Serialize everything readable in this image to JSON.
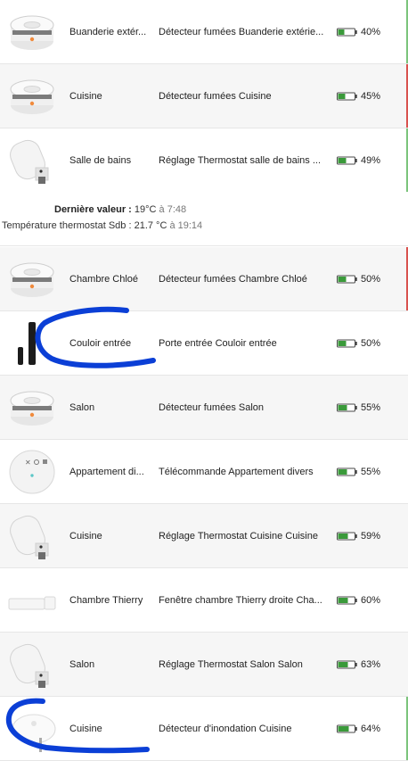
{
  "colors": {
    "battery_green": "#3a9a3a",
    "edge_green": "#7cc47c",
    "edge_red": "#d9534f",
    "scribble_blue": "#0b3fd6"
  },
  "rows": [
    {
      "icon": "smoke-detector-icon",
      "room": "Buanderie extér...",
      "desc": "Détecteur fumées Buanderie extérie...",
      "percent": "40%",
      "level": 0.4,
      "edge": "green"
    },
    {
      "icon": "smoke-detector-icon",
      "room": "Cuisine",
      "desc": "Détecteur fumées Cuisine",
      "percent": "45%",
      "level": 0.45,
      "edge": "red"
    },
    {
      "icon": "thermostat-valve-icon",
      "room": "Salle de bains",
      "desc": "Réglage Thermostat salle de bains ...",
      "percent": "49%",
      "level": 0.49,
      "edge": "green"
    },
    {
      "icon": "smoke-detector-icon",
      "room": "Chambre Chloé",
      "desc": "Détecteur fumées Chambre Chloé",
      "percent": "50%",
      "level": 0.5,
      "edge": "red"
    },
    {
      "icon": "door-sensor-icon",
      "room": "Couloir entrée",
      "desc": "Porte entrée Couloir entrée",
      "percent": "50%",
      "level": 0.5,
      "edge": "none"
    },
    {
      "icon": "smoke-detector-icon",
      "room": "Salon",
      "desc": "Détecteur fumées Salon",
      "percent": "55%",
      "level": 0.55,
      "edge": "none"
    },
    {
      "icon": "remote-control-icon",
      "room": "Appartement di...",
      "desc": "Télécommande Appartement divers",
      "percent": "55%",
      "level": 0.55,
      "edge": "none"
    },
    {
      "icon": "thermostat-valve-icon",
      "room": "Cuisine",
      "desc": "Réglage Thermostat Cuisine Cuisine",
      "percent": "59%",
      "level": 0.59,
      "edge": "none"
    },
    {
      "icon": "window-sensor-icon",
      "room": "Chambre Thierry",
      "desc": "Fenêtre chambre Thierry droite Cha...",
      "percent": "60%",
      "level": 0.6,
      "edge": "none"
    },
    {
      "icon": "thermostat-valve-icon",
      "room": "Salon",
      "desc": "Réglage Thermostat Salon Salon",
      "percent": "63%",
      "level": 0.63,
      "edge": "none"
    },
    {
      "icon": "water-leak-detector-icon",
      "room": "Cuisine",
      "desc": "Détecteur d'inondation Cuisine",
      "percent": "64%",
      "level": 0.64,
      "edge": "green"
    }
  ],
  "details": {
    "last_value_label": "Dernière valeur :",
    "last_value": "19°C",
    "last_value_time": "à 7:48",
    "thermostat_label": "Température thermostat Sdb :",
    "thermostat_value": "21.7 °C",
    "thermostat_time": "à 19:14"
  }
}
